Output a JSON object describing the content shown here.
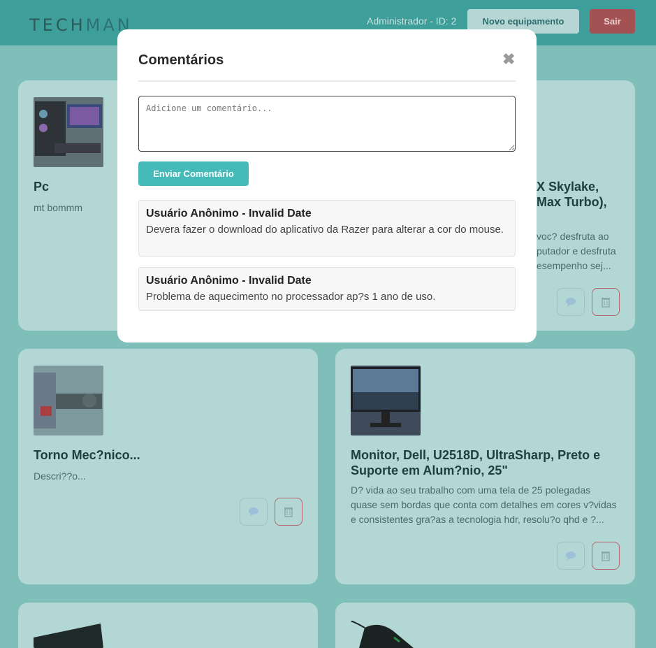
{
  "header": {
    "logo_tech": "TECH",
    "logo_man": "MAN",
    "user_info": "Administrador - ID: 2",
    "new_button": "Novo equipamento",
    "exit_button": "Sair"
  },
  "cards": [
    {
      "title": "Pc",
      "description": "mt bommm"
    },
    {
      "title_line1": "X Skylake,",
      "title_line2": "Max Turbo),",
      "desc_line1": "voc? desfruta ao",
      "desc_line2": "putador e desfruta",
      "desc_line3": "esempenho sej..."
    },
    {
      "title": "Torno Mec?nico...",
      "description": "Descri??o..."
    },
    {
      "title_line1": "Monitor, Dell, U2518D, UltraSharp, Preto e",
      "title_line2": "Suporte em Alum?nio, 25\"",
      "desc_line1": "D? vida ao seu trabalho com uma tela de 25 polegadas",
      "desc_line2": "quase sem bordas que conta com detalhes em cores v?vidas",
      "desc_line3": "e consistentes gra?as a tecnologia hdr, resolu?o qhd e ?..."
    }
  ],
  "icons": {
    "comment": "comment-icon",
    "delete": "trash-icon",
    "close": "close-icon"
  },
  "modal": {
    "title": "Comentários",
    "close": "✖",
    "input_placeholder": "Adicione um comentário...",
    "send_button": "Enviar Comentário",
    "comments": [
      {
        "author": "Usuário Anônimo - Invalid Date",
        "text": "Devera fazer o download do aplicativo da Razer para alterar a cor do mouse."
      },
      {
        "author": "Usuário Anônimo - Invalid Date",
        "text": "Problema de aquecimento no processador ap?s 1 ano de uso."
      }
    ]
  },
  "colors": {
    "accent": "#44bbb8",
    "header": "#3e9e9a",
    "danger": "#a35153"
  }
}
